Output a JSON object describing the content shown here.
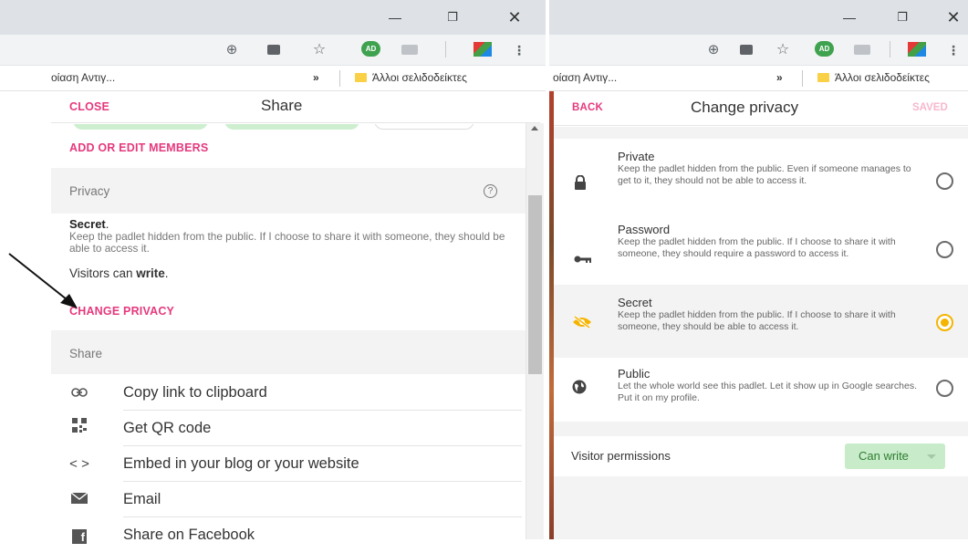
{
  "left": {
    "bookmarks": {
      "truncated_tab": "οίαση Αντιγ...",
      "more": "»",
      "other_bookmarks": "Άλλοι σελιδοδείκτες"
    },
    "profile_badge": "AD",
    "header": {
      "close": "CLOSE",
      "title": "Share"
    },
    "add_members": "ADD OR EDIT MEMBERS",
    "privacy_section": "Privacy",
    "privacy_help": "?",
    "privacy_level": "Secret",
    "privacy_level_suffix": ".",
    "privacy_description": "Keep the padlet hidden from the public. If I choose to share it with someone, they should be able to access it.",
    "visitors_prefix": "Visitors can ",
    "visitors_perm": "write",
    "visitors_suffix": ".",
    "change_privacy": "CHANGE PRIVACY",
    "share_section": "Share",
    "share_items": [
      {
        "label": "Copy link to clipboard",
        "icon": "link-icon"
      },
      {
        "label": "Get QR code",
        "icon": "qr-code-icon"
      },
      {
        "label": "Embed in your blog or your website",
        "icon": "code-icon"
      },
      {
        "label": "Email",
        "icon": "email-icon"
      },
      {
        "label": "Share on Facebook",
        "icon": "facebook-icon"
      }
    ]
  },
  "right": {
    "bookmarks": {
      "truncated_tab": "οίαση Αντιγ...",
      "more": "»",
      "other_bookmarks": "Άλλοι σελιδοδείκτες"
    },
    "profile_badge": "AD",
    "header": {
      "back": "BACK",
      "title": "Change privacy",
      "saved": "SAVED"
    },
    "options": [
      {
        "title": "Private",
        "desc": "Keep the padlet hidden from the public. Even if someone manages to get to it, they should not be able to access it.",
        "icon": "lock-icon",
        "selected": false
      },
      {
        "title": "Password",
        "desc": "Keep the padlet hidden from the public. If I choose to share it with someone, they should require a password to access it.",
        "icon": "key-icon",
        "selected": false
      },
      {
        "title": "Secret",
        "desc": "Keep the padlet hidden from the public. If I choose to share it with someone, they should be able to access it.",
        "icon": "eye-off-icon",
        "selected": true
      },
      {
        "title": "Public",
        "desc": "Let the whole world see this padlet. Let it show up in Google searches. Put it on my profile.",
        "icon": "globe-icon",
        "selected": false
      }
    ],
    "visitor_permissions_label": "Visitor permissions",
    "visitor_permissions_value": "Can write"
  },
  "colors": {
    "pink": "#e6397d",
    "selected_yellow": "#f5b400",
    "green_button": "#c8ebc9",
    "green_text": "#2f7d32"
  }
}
